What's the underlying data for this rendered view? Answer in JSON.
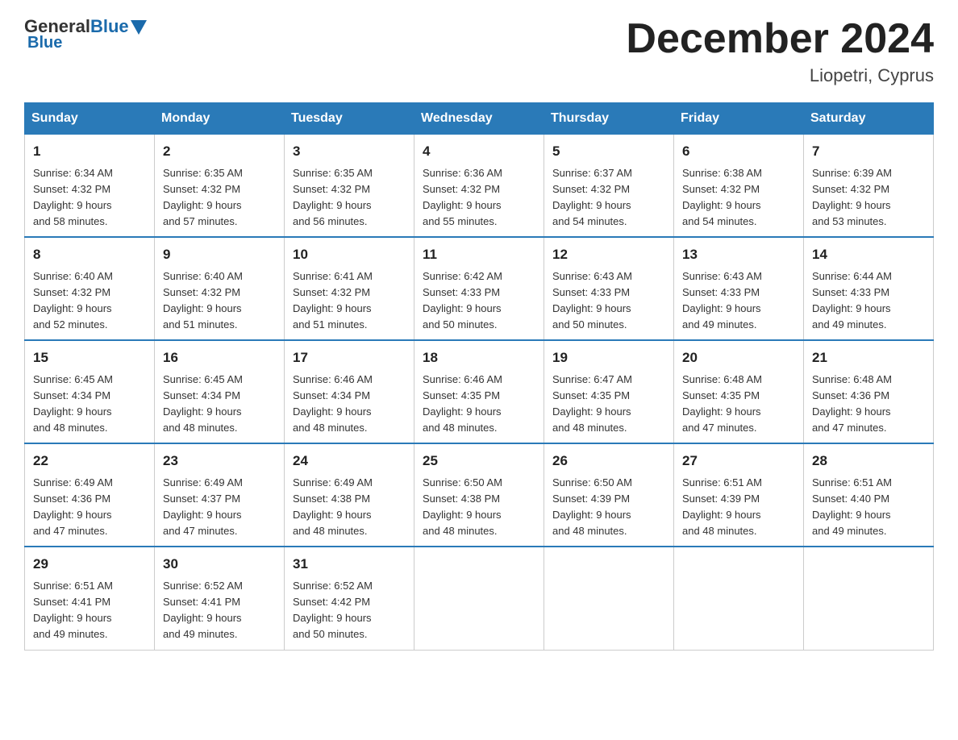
{
  "header": {
    "logo_general": "General",
    "logo_blue": "Blue",
    "month_title": "December 2024",
    "location": "Liopetri, Cyprus"
  },
  "weekdays": [
    "Sunday",
    "Monday",
    "Tuesday",
    "Wednesday",
    "Thursday",
    "Friday",
    "Saturday"
  ],
  "weeks": [
    [
      {
        "day": "1",
        "sunrise": "6:34 AM",
        "sunset": "4:32 PM",
        "daylight": "9 hours and 58 minutes."
      },
      {
        "day": "2",
        "sunrise": "6:35 AM",
        "sunset": "4:32 PM",
        "daylight": "9 hours and 57 minutes."
      },
      {
        "day": "3",
        "sunrise": "6:35 AM",
        "sunset": "4:32 PM",
        "daylight": "9 hours and 56 minutes."
      },
      {
        "day": "4",
        "sunrise": "6:36 AM",
        "sunset": "4:32 PM",
        "daylight": "9 hours and 55 minutes."
      },
      {
        "day": "5",
        "sunrise": "6:37 AM",
        "sunset": "4:32 PM",
        "daylight": "9 hours and 54 minutes."
      },
      {
        "day": "6",
        "sunrise": "6:38 AM",
        "sunset": "4:32 PM",
        "daylight": "9 hours and 54 minutes."
      },
      {
        "day": "7",
        "sunrise": "6:39 AM",
        "sunset": "4:32 PM",
        "daylight": "9 hours and 53 minutes."
      }
    ],
    [
      {
        "day": "8",
        "sunrise": "6:40 AM",
        "sunset": "4:32 PM",
        "daylight": "9 hours and 52 minutes."
      },
      {
        "day": "9",
        "sunrise": "6:40 AM",
        "sunset": "4:32 PM",
        "daylight": "9 hours and 51 minutes."
      },
      {
        "day": "10",
        "sunrise": "6:41 AM",
        "sunset": "4:32 PM",
        "daylight": "9 hours and 51 minutes."
      },
      {
        "day": "11",
        "sunrise": "6:42 AM",
        "sunset": "4:33 PM",
        "daylight": "9 hours and 50 minutes."
      },
      {
        "day": "12",
        "sunrise": "6:43 AM",
        "sunset": "4:33 PM",
        "daylight": "9 hours and 50 minutes."
      },
      {
        "day": "13",
        "sunrise": "6:43 AM",
        "sunset": "4:33 PM",
        "daylight": "9 hours and 49 minutes."
      },
      {
        "day": "14",
        "sunrise": "6:44 AM",
        "sunset": "4:33 PM",
        "daylight": "9 hours and 49 minutes."
      }
    ],
    [
      {
        "day": "15",
        "sunrise": "6:45 AM",
        "sunset": "4:34 PM",
        "daylight": "9 hours and 48 minutes."
      },
      {
        "day": "16",
        "sunrise": "6:45 AM",
        "sunset": "4:34 PM",
        "daylight": "9 hours and 48 minutes."
      },
      {
        "day": "17",
        "sunrise": "6:46 AM",
        "sunset": "4:34 PM",
        "daylight": "9 hours and 48 minutes."
      },
      {
        "day": "18",
        "sunrise": "6:46 AM",
        "sunset": "4:35 PM",
        "daylight": "9 hours and 48 minutes."
      },
      {
        "day": "19",
        "sunrise": "6:47 AM",
        "sunset": "4:35 PM",
        "daylight": "9 hours and 48 minutes."
      },
      {
        "day": "20",
        "sunrise": "6:48 AM",
        "sunset": "4:35 PM",
        "daylight": "9 hours and 47 minutes."
      },
      {
        "day": "21",
        "sunrise": "6:48 AM",
        "sunset": "4:36 PM",
        "daylight": "9 hours and 47 minutes."
      }
    ],
    [
      {
        "day": "22",
        "sunrise": "6:49 AM",
        "sunset": "4:36 PM",
        "daylight": "9 hours and 47 minutes."
      },
      {
        "day": "23",
        "sunrise": "6:49 AM",
        "sunset": "4:37 PM",
        "daylight": "9 hours and 47 minutes."
      },
      {
        "day": "24",
        "sunrise": "6:49 AM",
        "sunset": "4:38 PM",
        "daylight": "9 hours and 48 minutes."
      },
      {
        "day": "25",
        "sunrise": "6:50 AM",
        "sunset": "4:38 PM",
        "daylight": "9 hours and 48 minutes."
      },
      {
        "day": "26",
        "sunrise": "6:50 AM",
        "sunset": "4:39 PM",
        "daylight": "9 hours and 48 minutes."
      },
      {
        "day": "27",
        "sunrise": "6:51 AM",
        "sunset": "4:39 PM",
        "daylight": "9 hours and 48 minutes."
      },
      {
        "day": "28",
        "sunrise": "6:51 AM",
        "sunset": "4:40 PM",
        "daylight": "9 hours and 49 minutes."
      }
    ],
    [
      {
        "day": "29",
        "sunrise": "6:51 AM",
        "sunset": "4:41 PM",
        "daylight": "9 hours and 49 minutes."
      },
      {
        "day": "30",
        "sunrise": "6:52 AM",
        "sunset": "4:41 PM",
        "daylight": "9 hours and 49 minutes."
      },
      {
        "day": "31",
        "sunrise": "6:52 AM",
        "sunset": "4:42 PM",
        "daylight": "9 hours and 50 minutes."
      },
      null,
      null,
      null,
      null
    ]
  ],
  "labels": {
    "sunrise": "Sunrise:",
    "sunset": "Sunset:",
    "daylight": "Daylight:"
  }
}
